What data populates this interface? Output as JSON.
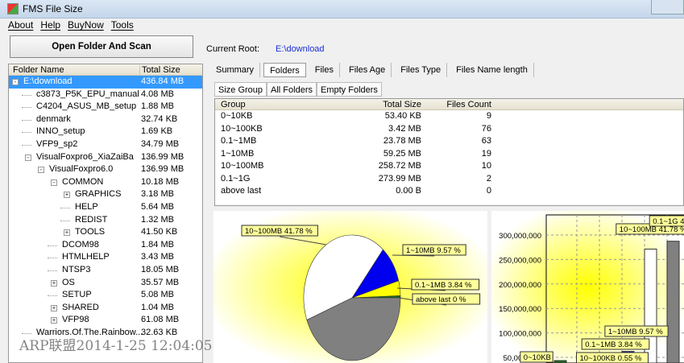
{
  "window": {
    "title": "FMS File Size"
  },
  "menu": [
    "About",
    "Help",
    "BuyNow",
    "Tools"
  ],
  "toolbar": {
    "scan_label": "Open Folder And Scan",
    "root_label": "Current Root:",
    "root_value": "E:\\download"
  },
  "tree": {
    "headers": [
      "Folder Name",
      "Total Size"
    ],
    "rows": [
      {
        "name": "E:\\download",
        "size": "436.84 MB",
        "level": 0,
        "toggle": "-",
        "selected": true
      },
      {
        "name": "c3873_P5K_EPU_manual",
        "size": "4.08 MB",
        "level": 1
      },
      {
        "name": "C4204_ASUS_MB_setup",
        "size": "1.88 MB",
        "level": 1
      },
      {
        "name": "denmark",
        "size": "32.74 KB",
        "level": 1
      },
      {
        "name": "INNO_setup",
        "size": "1.69 KB",
        "level": 1
      },
      {
        "name": "VFP9_sp2",
        "size": "34.79 MB",
        "level": 1
      },
      {
        "name": "VisualFoxpro6_XiaZaiBa",
        "size": "136.99 MB",
        "level": 1,
        "toggle": "-"
      },
      {
        "name": "VisualFoxpro6.0",
        "size": "136.99 MB",
        "level": 2,
        "toggle": "-"
      },
      {
        "name": "COMMON",
        "size": "10.18 MB",
        "level": 3,
        "toggle": "-"
      },
      {
        "name": "GRAPHICS",
        "size": "3.18 MB",
        "level": 4,
        "toggle": "+"
      },
      {
        "name": "HELP",
        "size": "5.64 MB",
        "level": 4
      },
      {
        "name": "REDIST",
        "size": "1.32 MB",
        "level": 4
      },
      {
        "name": "TOOLS",
        "size": "41.50 KB",
        "level": 4,
        "toggle": "+"
      },
      {
        "name": "DCOM98",
        "size": "1.84 MB",
        "level": 3
      },
      {
        "name": "HTMLHELP",
        "size": "3.43 MB",
        "level": 3
      },
      {
        "name": "NTSP3",
        "size": "18.05 MB",
        "level": 3
      },
      {
        "name": "OS",
        "size": "35.57 MB",
        "level": 3,
        "toggle": "+"
      },
      {
        "name": "SETUP",
        "size": "5.08 MB",
        "level": 3
      },
      {
        "name": "SHARED",
        "size": "1.04 MB",
        "level": 3,
        "toggle": "+"
      },
      {
        "name": "VFP98",
        "size": "61.08 MB",
        "level": 3,
        "toggle": "+"
      },
      {
        "name": "Warriors.Of.The.Rainbow...",
        "size": "32.63 KB",
        "level": 1
      }
    ]
  },
  "tabs": {
    "main": [
      "Summary",
      "Folders",
      "Files",
      "Files Age",
      "Files Type",
      "Files Name length"
    ],
    "active": 1,
    "sub": [
      "Size Group",
      "All Folders",
      "Empty Folders"
    ]
  },
  "grid": {
    "headers": [
      "Group",
      "Total Size",
      "Files Count"
    ],
    "rows": [
      [
        "0~10KB",
        "53.40 KB",
        "9"
      ],
      [
        "10~100KB",
        "3.42 MB",
        "76"
      ],
      [
        "0.1~1MB",
        "23.78 MB",
        "63"
      ],
      [
        "1~10MB",
        "59.25 MB",
        "19"
      ],
      [
        "10~100MB",
        "258.72 MB",
        "10"
      ],
      [
        "0.1~1G",
        "273.99 MB",
        "2"
      ],
      [
        "above last",
        "0.00 B",
        "0"
      ]
    ]
  },
  "chart_data": [
    {
      "type": "pie",
      "slices": [
        {
          "name": "above last",
          "pct": 0,
          "label": "above last 0 %",
          "color": "#1e6b1e"
        },
        {
          "name": "0~10KB",
          "pct": 0.01,
          "label": "",
          "color": "#1e6b1e"
        },
        {
          "name": "10~100KB",
          "pct": 0.55,
          "label": "",
          "color": "#1e6b1e"
        },
        {
          "name": "0.1~1MB",
          "pct": 3.84,
          "label": "0.1~1MB 3.84 %",
          "color": "#ffff00"
        },
        {
          "name": "1~10MB",
          "pct": 9.57,
          "label": "1~10MB 9.57 %",
          "color": "#0000ee"
        },
        {
          "name": "10~100MB",
          "pct": 41.78,
          "label": "10~100MB 41.78 %",
          "color": "#ffffff"
        },
        {
          "name": "0.1~1G",
          "pct": 44.26,
          "label": "",
          "color": "#808080"
        }
      ]
    },
    {
      "type": "bar",
      "ylim": [
        0,
        340000000
      ],
      "yticks": [
        "50,000,000",
        "100,000,000",
        "150,000,000",
        "200,000,000",
        "250,000,000",
        "300,000,000"
      ],
      "categories": [
        "0~10KB",
        "10~100KB",
        "0.1~1MB",
        "1~10MB",
        "10~100MB",
        "0.1~1G",
        "above last"
      ],
      "values": [
        54682,
        3586130,
        24935137,
        62128128,
        271286517,
        287298355,
        0
      ],
      "colors": [
        "#1e6b1e",
        "#1e6b1e",
        "#ffff00",
        "#0000ee",
        "#ffffff",
        "#808080",
        "#1e6b1e"
      ],
      "labels": [
        "0~10KB",
        "10~100KB 0.55 %",
        "0.1~1MB 3.84 %",
        "1~10MB 9.57 %",
        "10~100MB 41.78 %",
        "0.1~1G 44.26 %",
        "above"
      ]
    }
  ],
  "watermark": "ARP联盟2014-1-25 12:04:05"
}
